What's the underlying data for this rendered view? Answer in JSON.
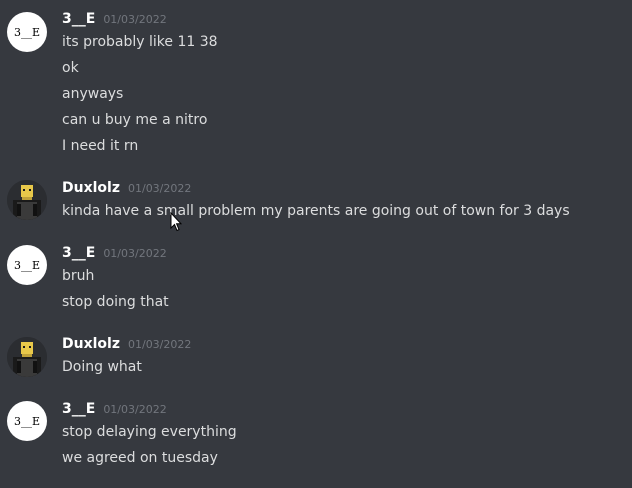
{
  "messages": [
    {
      "author": "3__E",
      "avatar_text": "3__E",
      "timestamp": "01/03/2022",
      "lines": [
        "its probably like 11 38",
        "ok",
        "anyways",
        "can u buy me a nitro",
        "I need it rn"
      ]
    },
    {
      "author": "Duxlolz",
      "timestamp": "01/03/2022",
      "lines": [
        "kinda have a small problem my parents are going out of town for 3 days"
      ]
    },
    {
      "author": "3__E",
      "avatar_text": "3__E",
      "timestamp": "01/03/2022",
      "lines": [
        "bruh",
        "stop doing that"
      ]
    },
    {
      "author": "Duxlolz",
      "timestamp": "01/03/2022",
      "lines": [
        "Doing what"
      ]
    },
    {
      "author": "3__E",
      "avatar_text": "3__E",
      "timestamp": "01/03/2022",
      "lines": [
        "stop delaying everything",
        "we agreed on tuesday"
      ]
    }
  ],
  "colors": {
    "background": "#36393f",
    "username": "#ffffff",
    "timestamp": "#72767d",
    "message_text": "#dcddde"
  },
  "icons": [
    "pointer-cursor-icon"
  ]
}
